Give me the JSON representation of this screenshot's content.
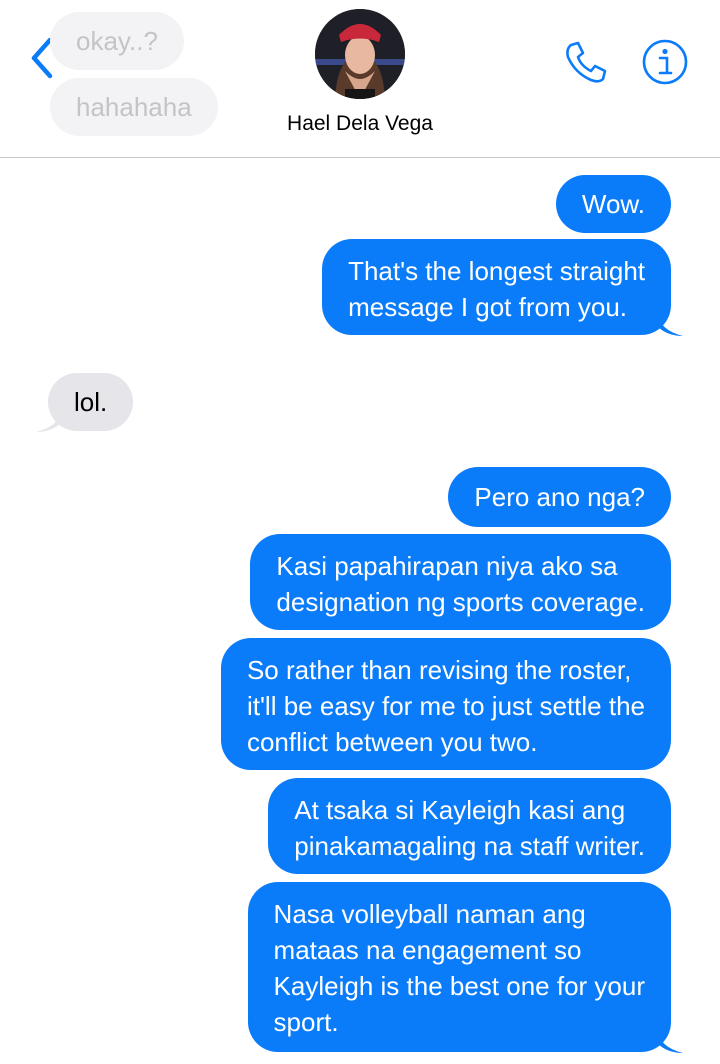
{
  "header": {
    "contact_name": "Hael Dela Vega",
    "previous_messages": [
      "okay..?",
      "hahahaha"
    ],
    "accent_color": "#0b7cf9"
  },
  "icons": {
    "back": "chevron-left-icon",
    "call": "phone-icon",
    "info": "info-icon"
  },
  "messages": [
    {
      "direction": "sent",
      "lines": [
        "Wow."
      ]
    },
    {
      "direction": "sent",
      "lines": [
        "That's the longest straight",
        "message I got from you."
      ]
    },
    {
      "direction": "received",
      "lines": [
        "lol."
      ]
    },
    {
      "direction": "sent",
      "lines": [
        "Pero ano nga?"
      ]
    },
    {
      "direction": "sent",
      "lines": [
        "Kasi papahirapan niya ako sa",
        "designation ng sports coverage."
      ]
    },
    {
      "direction": "sent",
      "lines": [
        "So rather than revising the roster,",
        "it'll be easy for me to just settle the",
        "conflict between you two."
      ]
    },
    {
      "direction": "sent",
      "lines": [
        "At tsaka si Kayleigh kasi ang",
        "pinakamagaling na staff writer."
      ]
    },
    {
      "direction": "sent",
      "lines": [
        "Nasa volleyball naman ang",
        "mataas na engagement so",
        "Kayleigh is the best one for your",
        "sport."
      ]
    }
  ]
}
